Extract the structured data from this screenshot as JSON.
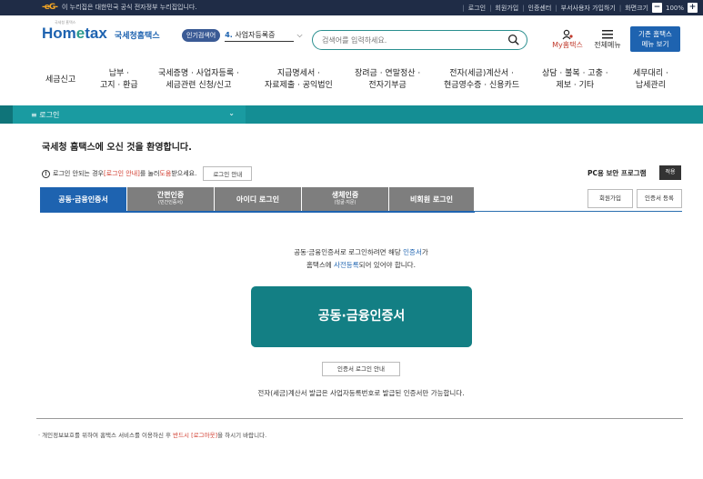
{
  "topbar": {
    "gov_logo": "-eG-",
    "gov_text": "이 누리집은 대한민국 공식 전자정부 누리집입니다.",
    "links": [
      "로그인",
      "회원가입",
      "인증센터",
      "부서사용자 가입하기",
      "화면크기"
    ],
    "zoom_minus": "−",
    "zoom_value": "100%",
    "zoom_plus": "+"
  },
  "header": {
    "logo_tiny": "국세청 홈택스",
    "logo_home": "Hom",
    "logo_e": "e",
    "logo_tax": "tax",
    "logo_sub": "국세청홈택스",
    "popular_tag": "인기검색어",
    "popular_num": "4.",
    "popular_kw": "사업자등록증",
    "search_placeholder": "검색어를 입력하세요.",
    "myhome": "My홈택스",
    "menu_all": "전체메뉴",
    "old_home_line1": "기존 홈택스",
    "old_home_line2": "메뉴 보기",
    "icons": {
      "search": "search-icon",
      "person": "person-icon",
      "menu": "hamburger-icon"
    }
  },
  "gnb": [
    {
      "l1": "세금신고",
      "l2": ""
    },
    {
      "l1": "납부 ·",
      "l2": "고지 · 환급"
    },
    {
      "l1": "국세증명 · 사업자등록 ·",
      "l2": "세금관련 신청/신고"
    },
    {
      "l1": "지급명세서 ·",
      "l2": "자료제출 · 공익법인"
    },
    {
      "l1": "장려금 · 연말정산 ·",
      "l2": "전자기부금"
    },
    {
      "l1": "전자(세금)계산서 ·",
      "l2": "현금영수증 · 신용카드"
    },
    {
      "l1": "상담 · 불복 · 고충 ·",
      "l2": "제보 · 기타"
    },
    {
      "l1": "세무대리 ·",
      "l2": "납세관리"
    }
  ],
  "breadcrumb": {
    "menu_icon": "≡",
    "label": "로그인",
    "chevron": "⌄"
  },
  "welcome": "국세청 홈택스에 오신 것을 환영합니다.",
  "notice": {
    "icon": "!",
    "pre": "로그인 안되는 경우 ",
    "red1": "[로그인 안내]",
    "mid": "를 눌러 ",
    "red2": "도움",
    "post": "받으세요.",
    "button": "로그인 안내"
  },
  "pc_security": {
    "label": "PC용 보안 프로그램",
    "button": "적용"
  },
  "tabs": [
    {
      "label": "공동·금융인증서",
      "sub": "",
      "active": true
    },
    {
      "label": "간편인증",
      "sub": "(민간인증서)",
      "active": false
    },
    {
      "label": "아이디 로그인",
      "sub": "",
      "active": false
    },
    {
      "label": "생체인증",
      "sub": "(얼굴·지문)",
      "active": false
    },
    {
      "label": "비회원 로그인",
      "sub": "",
      "active": false
    }
  ],
  "side_buttons": {
    "join": "회원가입",
    "cert_register": "인증서 등록"
  },
  "content": {
    "desc1_pre": "공동·금융인증서로 로그인하려면 해당 ",
    "desc1_blue": "인증서",
    "desc1_post": "가",
    "desc2_pre": "홈택스에 ",
    "desc2_blue": "사전등록",
    "desc2_post": "되어 있어야 합니다.",
    "big_button": "공동·금융인증서",
    "guide_button": "인증서 로그인 안내",
    "note": "전자(세금)계산서 발급은 사업자등록번호로 발급된 인증서만 가능합니다."
  },
  "footer": {
    "pre": "· 개인정보보호를 위하여 홈택스 서비스를 이용하신 후 ",
    "red": "반드시 [로그아웃]",
    "post": "을 하시기 바랍니다."
  }
}
